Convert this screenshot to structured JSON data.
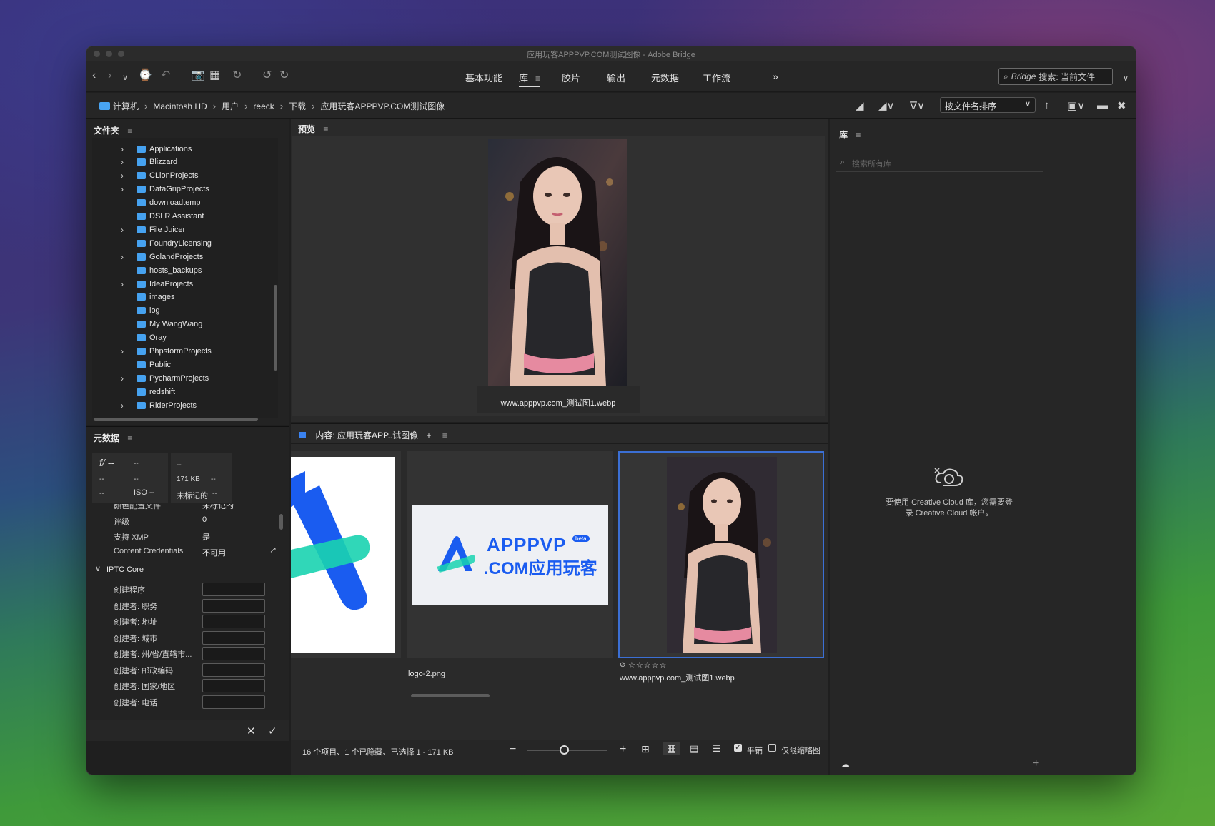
{
  "window": {
    "title": "应用玩客APPPVP.COM测试图像 - Adobe Bridge"
  },
  "toolbar": {
    "workspaces": [
      "基本功能",
      "库",
      "胶片",
      "输出",
      "元数据",
      "工作流"
    ],
    "active_workspace": "库",
    "more": "»",
    "search_label": "Bridge",
    "search_text": "搜索: 当前文件"
  },
  "path": {
    "crumbs": [
      "计算机",
      "Macintosh HD",
      "用户",
      "reeck",
      "下载",
      "应用玩客APPPVP.COM测试图像"
    ],
    "sort_label": "按文件名排序"
  },
  "folders": {
    "title": "文件夹",
    "menu": "≡",
    "items": [
      {
        "name": "Applications",
        "expandable": true
      },
      {
        "name": "Blizzard",
        "expandable": true
      },
      {
        "name": "CLionProjects",
        "expandable": true
      },
      {
        "name": "DataGripProjects",
        "expandable": true
      },
      {
        "name": "downloadtemp",
        "expandable": false
      },
      {
        "name": "DSLR Assistant",
        "expandable": false
      },
      {
        "name": "File Juicer",
        "expandable": true
      },
      {
        "name": "FoundryLicensing",
        "expandable": false
      },
      {
        "name": "GolandProjects",
        "expandable": true
      },
      {
        "name": "hosts_backups",
        "expandable": false
      },
      {
        "name": "IdeaProjects",
        "expandable": true
      },
      {
        "name": "images",
        "expandable": false
      },
      {
        "name": "log",
        "expandable": false
      },
      {
        "name": "My WangWang",
        "expandable": false
      },
      {
        "name": "Oray",
        "expandable": false
      },
      {
        "name": "PhpstormProjects",
        "expandable": true
      },
      {
        "name": "Public",
        "expandable": false
      },
      {
        "name": "PycharmProjects",
        "expandable": true
      },
      {
        "name": "redshift",
        "expandable": false
      },
      {
        "name": "RiderProjects",
        "expandable": true
      }
    ]
  },
  "metadata": {
    "title": "元数据",
    "menu": "≡",
    "camera": {
      "aperture": "f/ --",
      "shutter": "--",
      "r2c1": "--",
      "r2c2": "--",
      "r3c1": "--",
      "iso": "ISO --",
      "c2r1": "--",
      "size": "171 KB",
      "size_extra": "--",
      "label": "未标记的",
      "label_extra": "--"
    },
    "partial_row": {
      "key": "颜色配置文件",
      "value": "未标记的"
    },
    "rows": [
      {
        "key": "评级",
        "value": "0"
      },
      {
        "key": "支持 XMP",
        "value": "是"
      },
      {
        "key": "Content Credentials",
        "value": "不可用"
      }
    ],
    "iptc_title": "IPTC Core",
    "iptc_fields": [
      "创建程序",
      "创建者: 职务",
      "创建者: 地址",
      "创建者: 城市",
      "创建者: 州/省/直辖市...",
      "创建者: 邮政编码",
      "创建者: 国家/地区",
      "创建者: 电话"
    ]
  },
  "preview": {
    "title": "预览",
    "menu": "≡",
    "caption": "www.apppvp.com_测试图1.webp"
  },
  "content": {
    "title": "内容: 应用玩客APP..试图像",
    "add": "+",
    "menu": "≡",
    "thumbs": [
      {
        "name": ""
      },
      {
        "name": "logo-2.png"
      },
      {
        "name": "www.apppvp.com_测试图1.webp",
        "stars": "☆☆☆☆☆"
      }
    ],
    "logo_text_1": "APPPVP",
    "logo_text_2": ".COM应用玩客",
    "logo_badge": "beta"
  },
  "status": {
    "summary": "16 个项目、1 个已隐藏、已选择 1 - 171 KB",
    "tile_label": "平铺",
    "thumb_only_label": "仅限缩略图"
  },
  "library": {
    "title": "库",
    "menu": "≡",
    "search_placeholder": "搜索所有库",
    "message_line1": "要使用 Creative Cloud 库，您需要登",
    "message_line2": "录 Creative Cloud 帐户。"
  },
  "colors": {
    "accent": "#3b6fd4",
    "folder": "#46a2f0",
    "panel": "#232323",
    "logo_blue": "#1a5cf0",
    "logo_teal": "#19d3b0"
  }
}
